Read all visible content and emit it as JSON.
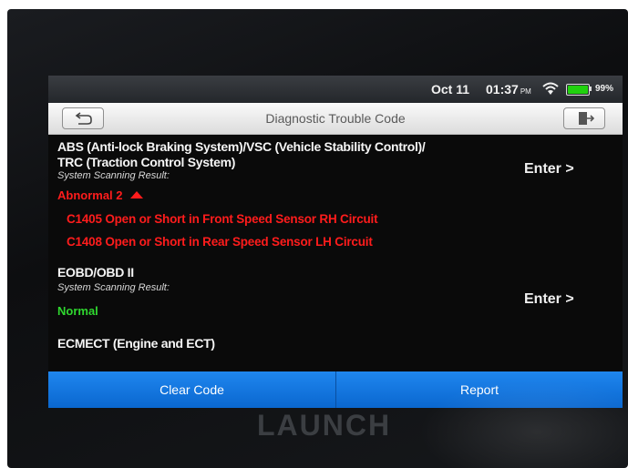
{
  "status_bar": {
    "date": "Oct 11",
    "time": "01:37",
    "ampm": "PM",
    "battery_pct": "99%",
    "battery_level": 0.99,
    "wifi_icon": "wifi-icon",
    "battery_icon": "battery-icon"
  },
  "header": {
    "title": "Diagnostic Trouble Code",
    "back_icon": "back-arrow-icon",
    "exit_icon": "exit-icon"
  },
  "systems": [
    {
      "name_line1": "ABS (Anti-lock Braking System)/VSC (Vehicle Stability Control)/",
      "name_line2": "TRC (Traction Control System)",
      "scan_label": "System Scanning Result:",
      "status": "Abnormal 2",
      "enter_label": "Enter >",
      "codes": [
        "C1405 Open or Short in Front Speed Sensor RH Circuit",
        "C1408 Open or Short in Rear Speed Sensor LH Circuit"
      ]
    },
    {
      "name": "EOBD/OBD II",
      "scan_label": "System Scanning Result:",
      "status": "Normal",
      "enter_label": "Enter >"
    },
    {
      "name": "ECMECT (Engine and ECT)"
    }
  ],
  "footer": {
    "clear_label": "Clear Code",
    "report_label": "Report"
  },
  "device": {
    "brand": "LAUNCH"
  },
  "colors": {
    "error": "#ff1c1c",
    "ok": "#2fd72f",
    "accent": "#1f86ef"
  }
}
